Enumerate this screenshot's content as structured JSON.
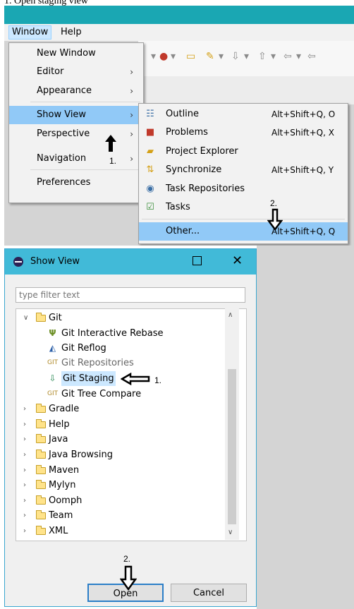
{
  "caption": "1. Open staging view",
  "menubar": {
    "window_label": "Window",
    "help_label": "Help"
  },
  "window_menu": {
    "items": [
      "New Window",
      "Editor",
      "Appearance",
      "Show View",
      "Perspective",
      "Navigation",
      "Preferences"
    ]
  },
  "show_view_menu": {
    "items": [
      {
        "label": "Outline",
        "shortcut": "Alt+Shift+Q, O",
        "icon": "outline-icon"
      },
      {
        "label": "Problems",
        "shortcut": "Alt+Shift+Q, X",
        "icon": "problems-icon"
      },
      {
        "label": "Project Explorer",
        "shortcut": "",
        "icon": "project-explorer-icon"
      },
      {
        "label": "Synchronize",
        "shortcut": "Alt+Shift+Q, Y",
        "icon": "synchronize-icon"
      },
      {
        "label": "Task Repositories",
        "shortcut": "",
        "icon": "task-repositories-icon"
      },
      {
        "label": "Tasks",
        "shortcut": "",
        "icon": "tasks-icon"
      },
      {
        "label": "Other...",
        "shortcut": "Alt+Shift+Q, Q",
        "icon": ""
      }
    ]
  },
  "annotations": {
    "step1": "1.",
    "step2": "2."
  },
  "dialog": {
    "title": "Show View",
    "filter_placeholder": "type filter text",
    "tree": {
      "git_label": "Git",
      "git_children": [
        "Git Interactive Rebase",
        "Git Reflog",
        "Git Repositories",
        "Git Staging",
        "Git Tree Compare"
      ],
      "folders": [
        "Gradle",
        "Help",
        "Java",
        "Java Browsing",
        "Maven",
        "Mylyn",
        "Oomph",
        "Team",
        "XML"
      ]
    },
    "open_label": "Open",
    "cancel_label": "Cancel"
  },
  "colors": {
    "title_bar": "#41bad8",
    "menu_highlight": "#91c9f7",
    "teal_bar": "#1aa7b3"
  }
}
